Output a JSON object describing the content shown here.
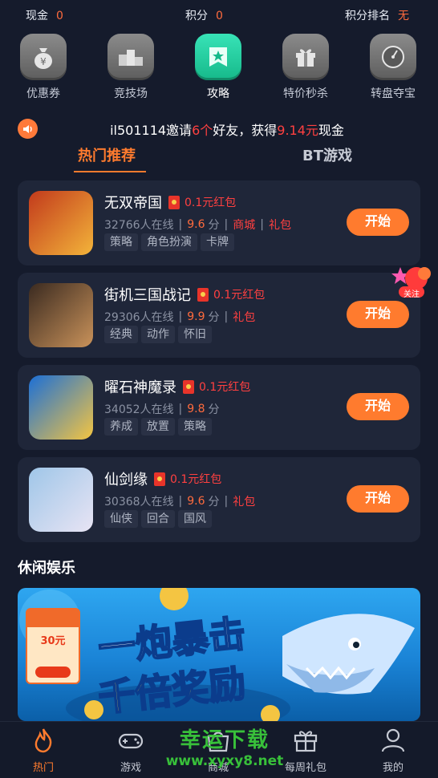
{
  "topbar": {
    "cash_label": "现金",
    "cash_value": "0",
    "points_label": "积分",
    "points_value": "0",
    "rank_label": "积分排名",
    "rank_value": "无"
  },
  "quick_menu": [
    {
      "label": "优惠券",
      "icon": "money-bag-icon",
      "active": false
    },
    {
      "label": "竞技场",
      "icon": "podium-icon",
      "active": false
    },
    {
      "label": "攻略",
      "icon": "star-book-icon",
      "active": true
    },
    {
      "label": "特价秒杀",
      "icon": "gift-icon",
      "active": false
    },
    {
      "label": "转盘夺宝",
      "icon": "wheel-icon",
      "active": false
    }
  ],
  "notice": {
    "user": "il501114",
    "t1": "邀请",
    "count": "6个",
    "t2": "好友，获得",
    "amount": "9.14元",
    "t3": "现金"
  },
  "tabs": {
    "hot": "热门推荐",
    "bt": "BT游戏"
  },
  "games": [
    {
      "name": "无双帝国",
      "redpack": "0.1元红包",
      "online": "32766人在线",
      "score": "9.6",
      "unit": "分",
      "links": [
        "商城",
        "礼包"
      ],
      "tags": [
        "策略",
        "角色扮演",
        "卡牌"
      ],
      "button": "开始",
      "colors": [
        "#c23a1c",
        "#f3b43a"
      ]
    },
    {
      "name": "街机三国战记",
      "redpack": "0.1元红包",
      "online": "29306人在线",
      "score": "9.9",
      "unit": "分",
      "links": [
        "礼包"
      ],
      "tags": [
        "经典",
        "动作",
        "怀旧"
      ],
      "button": "开始",
      "colors": [
        "#3a2a20",
        "#c9925a"
      ]
    },
    {
      "name": "曜石神魔录",
      "redpack": "0.1元红包",
      "online": "34052人在线",
      "score": "9.8",
      "unit": "分",
      "links": [],
      "tags": [
        "养成",
        "放置",
        "策略"
      ],
      "button": "开始",
      "colors": [
        "#1c6fd6",
        "#f4c542"
      ]
    },
    {
      "name": "仙剑缘",
      "redpack": "0.1元红包",
      "online": "30368人在线",
      "score": "9.6",
      "unit": "分",
      "links": [
        "礼包"
      ],
      "tags": [
        "仙侠",
        "回合",
        "国风"
      ],
      "button": "开始",
      "colors": [
        "#9fc6e8",
        "#e8e4f4"
      ]
    }
  ],
  "follow_badge": "关注",
  "section_leisure": "休闲娱乐",
  "banner": {
    "line1": "一炮暴击",
    "line2": "千倍奖励",
    "coupon_amount": "30元"
  },
  "bottom_nav": [
    {
      "label": "热门",
      "icon": "flame-icon",
      "active": true
    },
    {
      "label": "游戏",
      "icon": "gamepad-icon",
      "active": false
    },
    {
      "label": "商城",
      "icon": "shop-icon",
      "active": false
    },
    {
      "label": "每周礼包",
      "icon": "gift-icon",
      "active": false
    },
    {
      "label": "我的",
      "icon": "user-icon",
      "active": false
    }
  ],
  "watermark": {
    "line1": "幸运下载",
    "line2": "www.xyxy8.net"
  },
  "colors": {
    "accent": "#ff7b2e",
    "bg": "#151b2c",
    "card": "#1f2639",
    "red": "#ff4040"
  }
}
